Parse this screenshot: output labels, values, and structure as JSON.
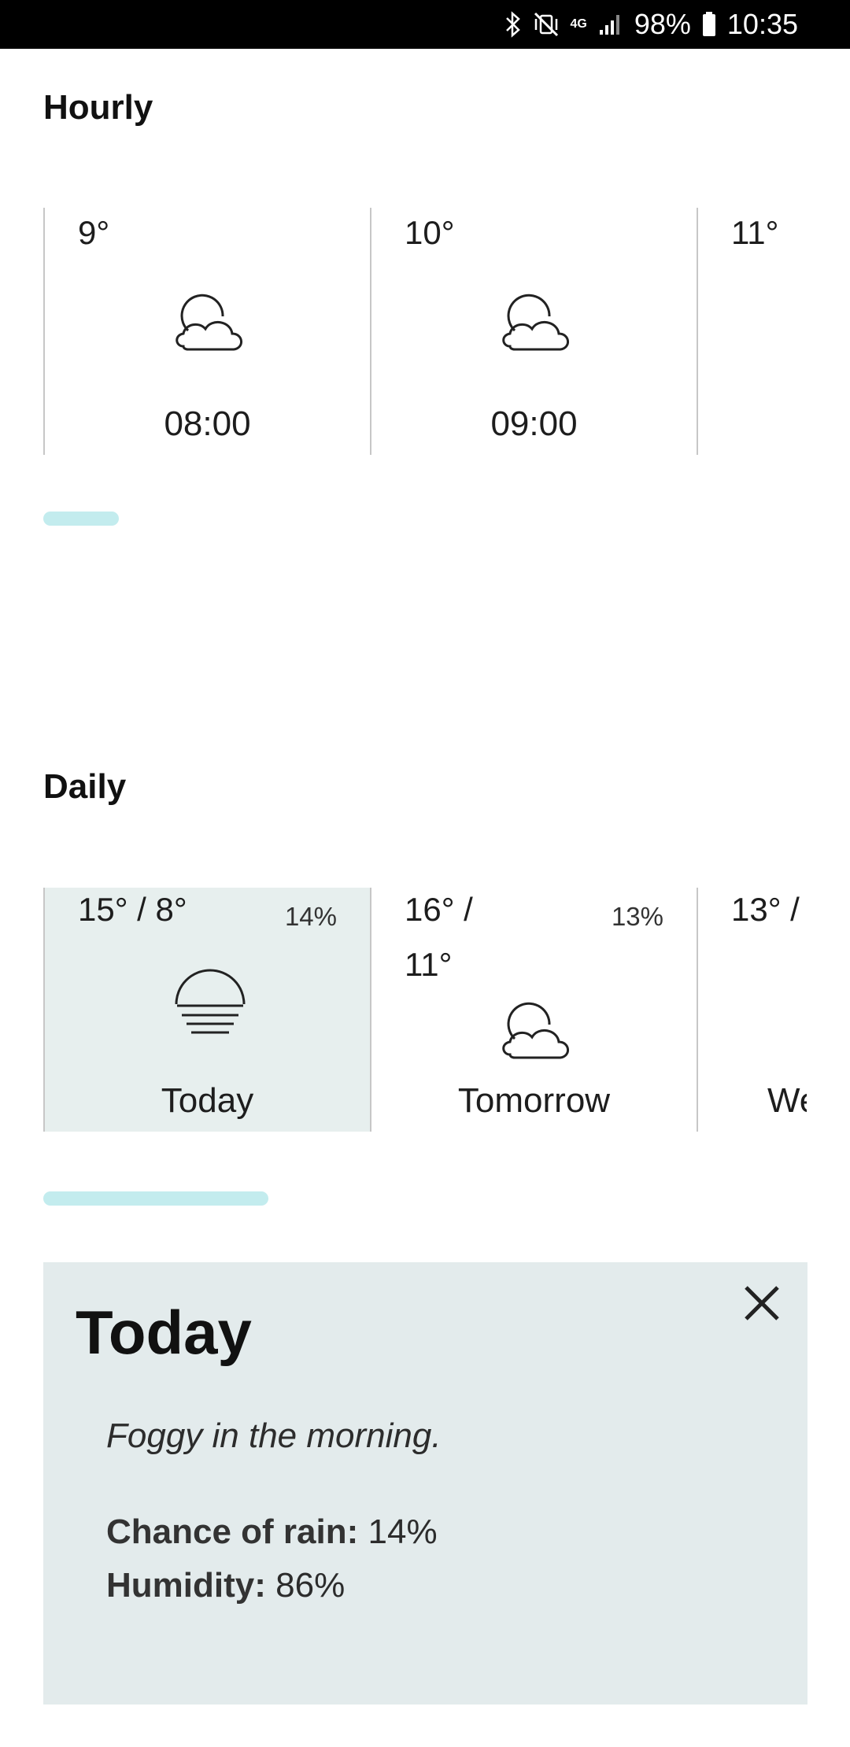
{
  "status_bar": {
    "battery": "98%",
    "time": "10:35",
    "network": "4G"
  },
  "hourly": {
    "title": "Hourly",
    "items": [
      {
        "temp": "9°",
        "time": "08:00",
        "icon": "partly-cloudy-icon"
      },
      {
        "temp": "10°",
        "time": "09:00",
        "icon": "partly-cloudy-icon"
      },
      {
        "temp": "11°",
        "time": "",
        "icon": ""
      }
    ],
    "scroll_position": 0.0
  },
  "daily": {
    "title": "Daily",
    "items": [
      {
        "temp": "15° / 8°",
        "rain": "14%",
        "label": "Today",
        "icon": "fog-icon",
        "selected": true
      },
      {
        "temp": "16° /",
        "temp2": "11°",
        "rain": "13%",
        "label": "Tomorrow",
        "icon": "partly-cloudy-icon",
        "selected": false
      },
      {
        "temp": "13° /",
        "label": "We",
        "selected": false
      }
    ]
  },
  "detail": {
    "title": "Today",
    "summary": "Foggy in the morning.",
    "rain_label": "Chance of rain:",
    "rain_value": "14%",
    "humidity_label": "Humidity:",
    "humidity_value": "86%"
  },
  "colors": {
    "accent_scroll": "#c3ecee",
    "selected_bg": "#e7efee",
    "detail_bg": "#e3ebec"
  }
}
